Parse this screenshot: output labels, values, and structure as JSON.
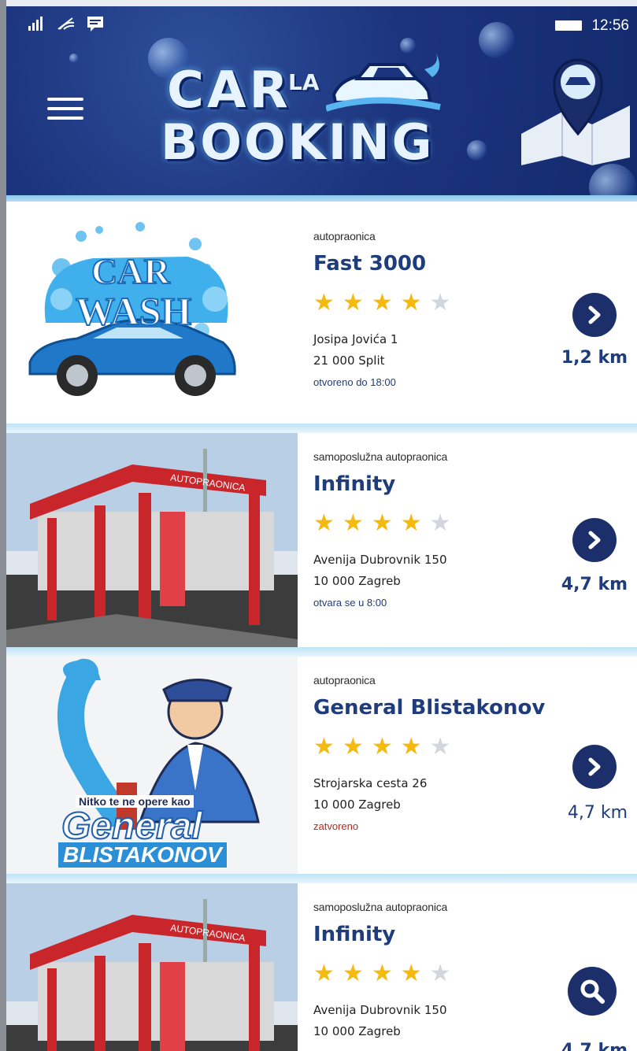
{
  "status_bar": {
    "time": "12:56",
    "icons": [
      "signal-icon",
      "wifi-icon",
      "message-icon",
      "battery-icon"
    ]
  },
  "header": {
    "menu_icon": "hamburger-menu-icon",
    "logo": {
      "line1": "CAR",
      "small": "LA",
      "line2": "BOOKING"
    },
    "map_icon": "map-pin-icon"
  },
  "colors": {
    "header_bg": "#1c347d",
    "accent": "#1f3c7d",
    "star_on": "#f6b90d",
    "star_off": "#d2d6df",
    "closed": "#b52a1e"
  },
  "listings": [
    {
      "category": "autopraonica",
      "name": "Fast 3000",
      "rating": 4,
      "rating_max": 5,
      "address_line1": "Josipa Jovića 1",
      "address_line2": "21 000 Split",
      "hours": "otvoreno do 18:00",
      "distance": "1,2 km",
      "action_icon": "chevron-right-icon",
      "thumb_logo_line1": "CAR",
      "thumb_logo_line2": "WASH"
    },
    {
      "category": "samoposlužna autopraonica",
      "name": "Infinity",
      "rating": 4,
      "rating_max": 5,
      "address_line1": "Avenija Dubrovnik 150",
      "address_line2": "10 000 Zagreb",
      "hours": "otvara se u 8:00",
      "distance": "4,7 km",
      "action_icon": "chevron-right-icon",
      "thumb_sign": "AUTOPRAONICA"
    },
    {
      "category": "autopraonica",
      "name": "General Blistakonov",
      "rating": 4,
      "rating_max": 5,
      "address_line1": "Strojarska cesta 26",
      "address_line2": "10 000 Zagreb",
      "hours": "zatvoreno",
      "distance": "4,7 km",
      "action_icon": "chevron-right-icon",
      "thumb_tagline": "Nitko te ne opere kao",
      "thumb_logo_line1": "General",
      "thumb_logo_line2": "BLISTAKONOV"
    },
    {
      "category": "samoposlužna autopraonica",
      "name": "Infinity",
      "rating": 4,
      "rating_max": 5,
      "address_line1": "Avenija Dubrovnik 150",
      "address_line2": "10 000 Zagreb",
      "distance": "4,7 km",
      "action_icon": "search-icon",
      "thumb_sign": "AUTOPRAONICA"
    }
  ]
}
